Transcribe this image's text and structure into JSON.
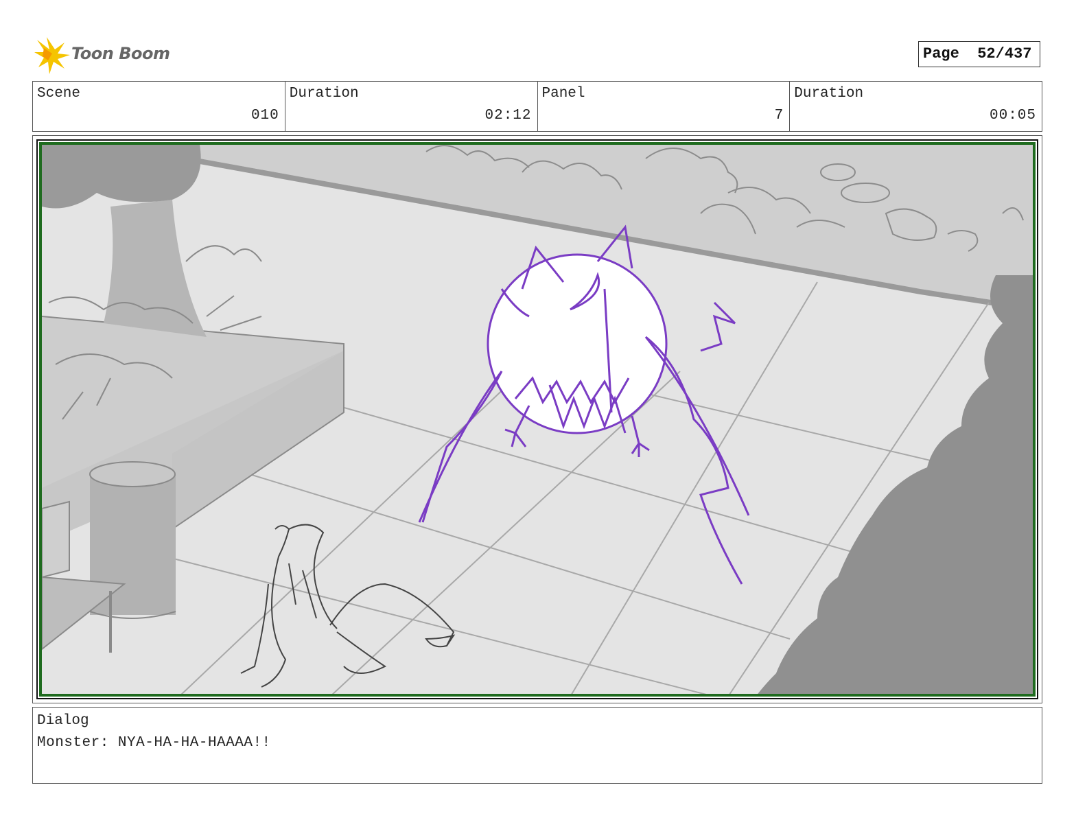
{
  "header": {
    "logo_text": "Toon Boom",
    "page_label": "Page",
    "page_value": "52/437"
  },
  "info": {
    "scene_label": "Scene",
    "scene_value": "010",
    "duration_label": "Duration",
    "duration_value": "02:12",
    "panel_label": "Panel",
    "panel_value": "7",
    "panel_duration_label": "Duration",
    "panel_duration_value": "00:05"
  },
  "dialog": {
    "label": "Dialog",
    "text": "Monster: NYA-HA-HA-HAAAA!!"
  },
  "colors": {
    "frame_border": "#1f6b1f",
    "monster_stroke": "#7a3cc4",
    "logo_star": "#f5c400"
  }
}
